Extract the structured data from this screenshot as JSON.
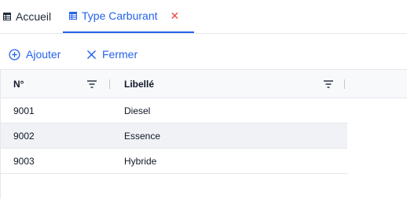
{
  "tabs": [
    {
      "label": "Accueil",
      "active": false,
      "icon": "table-icon"
    },
    {
      "label": "Type Carburant",
      "active": true,
      "icon": "table-icon",
      "closable": true
    }
  ],
  "toolbar": {
    "add_label": "Ajouter",
    "close_label": "Fermer"
  },
  "grid": {
    "columns": [
      {
        "label": "N°"
      },
      {
        "label": "Libellé"
      }
    ],
    "rows": [
      {
        "num": "9001",
        "libelle": "Diesel"
      },
      {
        "num": "9002",
        "libelle": "Essence"
      },
      {
        "num": "9003",
        "libelle": "Hybride"
      }
    ]
  },
  "colors": {
    "accent": "#2563eb",
    "close": "#ef4444",
    "header_bg": "#f8f9fb",
    "alt_row_bg": "#f0f2f6"
  }
}
